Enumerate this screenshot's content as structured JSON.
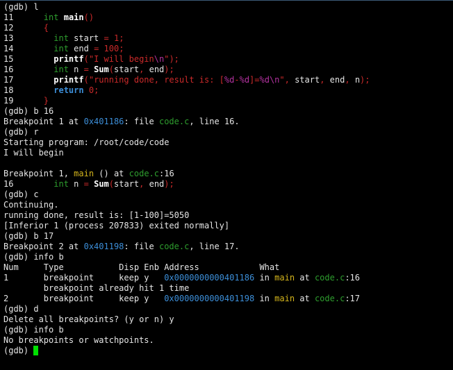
{
  "theme": {
    "background": "#000000",
    "default": "#e6e6e6",
    "cursor": "#00e000",
    "colors": {
      "n": "#e6e6e6",
      "t": "#2e9e2e",
      "k": "#2e9e2e",
      "p": "#cc2a2a",
      "m": "#b2329f",
      "fb": "#ffffff",
      "kb": "#3c8ed8",
      "v": "#cc2a2a",
      "a": "#3c8ed8",
      "f": "#2e9e2e",
      "fn": "#d4b51c"
    }
  },
  "terminal": {
    "lines": [
      [
        [
          "n",
          "(gdb) l"
        ]
      ],
      [
        [
          "n",
          "11      "
        ],
        [
          "t",
          "int"
        ],
        [
          "n",
          " "
        ],
        [
          "fb",
          "main"
        ],
        [
          "p",
          "()"
        ]
      ],
      [
        [
          "n",
          "12      "
        ],
        [
          "p",
          "{"
        ]
      ],
      [
        [
          "n",
          "13        "
        ],
        [
          "t",
          "int"
        ],
        [
          "n",
          " start "
        ],
        [
          "p",
          "="
        ],
        [
          "n",
          " "
        ],
        [
          "v",
          "1"
        ],
        [
          "p",
          ";"
        ]
      ],
      [
        [
          "n",
          "14        "
        ],
        [
          "t",
          "int"
        ],
        [
          "n",
          " end "
        ],
        [
          "p",
          "="
        ],
        [
          "n",
          " "
        ],
        [
          "v",
          "100"
        ],
        [
          "p",
          ";"
        ]
      ],
      [
        [
          "n",
          "15        "
        ],
        [
          "fb",
          "printf"
        ],
        [
          "p",
          "(\""
        ],
        [
          "p",
          "I will begin"
        ],
        [
          "m",
          "\\n"
        ],
        [
          "p",
          "\");"
        ]
      ],
      [
        [
          "n",
          "16        "
        ],
        [
          "t",
          "int"
        ],
        [
          "n",
          " n "
        ],
        [
          "p",
          "="
        ],
        [
          "n",
          " "
        ],
        [
          "fb",
          "Sum"
        ],
        [
          "p",
          "("
        ],
        [
          "n",
          "start"
        ],
        [
          "p",
          ","
        ],
        [
          "n",
          " end"
        ],
        [
          "p",
          ");"
        ]
      ],
      [
        [
          "n",
          "17        "
        ],
        [
          "fb",
          "printf"
        ],
        [
          "p",
          "(\""
        ],
        [
          "p",
          "running done, result is: ["
        ],
        [
          "m",
          "%d"
        ],
        [
          "p",
          "-"
        ],
        [
          "m",
          "%d"
        ],
        [
          "p",
          "]="
        ],
        [
          "m",
          "%d\\n"
        ],
        [
          "p",
          "\","
        ],
        [
          "n",
          " start"
        ],
        [
          "p",
          ","
        ],
        [
          "n",
          " end"
        ],
        [
          "p",
          ","
        ],
        [
          "n",
          " n"
        ],
        [
          "p",
          ");"
        ]
      ],
      [
        [
          "n",
          "18        "
        ],
        [
          "kb",
          "return"
        ],
        [
          "n",
          " "
        ],
        [
          "v",
          "0"
        ],
        [
          "p",
          ";"
        ]
      ],
      [
        [
          "n",
          "19      "
        ],
        [
          "p",
          "}"
        ]
      ],
      [
        [
          "n",
          "(gdb) b 16"
        ]
      ],
      [
        [
          "n",
          "Breakpoint 1 at "
        ],
        [
          "a",
          "0x401186"
        ],
        [
          "n",
          ": file "
        ],
        [
          "f",
          "code.c"
        ],
        [
          "n",
          ", line 16."
        ]
      ],
      [
        [
          "n",
          "(gdb) r"
        ]
      ],
      [
        [
          "n",
          "Starting program: /root/code/code"
        ]
      ],
      [
        [
          "n",
          "I will begin"
        ]
      ],
      [
        [
          "n",
          ""
        ]
      ],
      [
        [
          "n",
          "Breakpoint 1, "
        ],
        [
          "fn",
          "main"
        ],
        [
          "n",
          " () at "
        ],
        [
          "f",
          "code.c"
        ],
        [
          "n",
          ":16"
        ]
      ],
      [
        [
          "n",
          "16        "
        ],
        [
          "t",
          "int"
        ],
        [
          "n",
          " n "
        ],
        [
          "p",
          "="
        ],
        [
          "n",
          " "
        ],
        [
          "fb",
          "Sum"
        ],
        [
          "p",
          "("
        ],
        [
          "n",
          "start"
        ],
        [
          "p",
          ","
        ],
        [
          "n",
          " end"
        ],
        [
          "p",
          ");"
        ]
      ],
      [
        [
          "n",
          "(gdb) c"
        ]
      ],
      [
        [
          "n",
          "Continuing."
        ]
      ],
      [
        [
          "n",
          "running done, result is: [1-100]=5050"
        ]
      ],
      [
        [
          "n",
          "[Inferior 1 (process 207833) exited normally]"
        ]
      ],
      [
        [
          "n",
          "(gdb) b 17"
        ]
      ],
      [
        [
          "n",
          "Breakpoint 2 at "
        ],
        [
          "a",
          "0x401198"
        ],
        [
          "n",
          ": file "
        ],
        [
          "f",
          "code.c"
        ],
        [
          "n",
          ", line 17."
        ]
      ],
      [
        [
          "n",
          "(gdb) info b"
        ]
      ],
      [
        [
          "n",
          "Num     Type           Disp Enb Address            What"
        ]
      ],
      [
        [
          "n",
          "1       breakpoint     keep y   "
        ],
        [
          "a",
          "0x0000000000401186"
        ],
        [
          "n",
          " in "
        ],
        [
          "fn",
          "main"
        ],
        [
          "n",
          " at "
        ],
        [
          "f",
          "code.c"
        ],
        [
          "n",
          ":16"
        ]
      ],
      [
        [
          "n",
          "        breakpoint already hit 1 time"
        ]
      ],
      [
        [
          "n",
          "2       breakpoint     keep y   "
        ],
        [
          "a",
          "0x0000000000401198"
        ],
        [
          "n",
          " in "
        ],
        [
          "fn",
          "main"
        ],
        [
          "n",
          " at "
        ],
        [
          "f",
          "code.c"
        ],
        [
          "n",
          ":17"
        ]
      ],
      [
        [
          "n",
          "(gdb) d"
        ]
      ],
      [
        [
          "n",
          "Delete all breakpoints? (y or n) y"
        ]
      ],
      [
        [
          "n",
          "(gdb) info b"
        ]
      ],
      [
        [
          "n",
          "No breakpoints or watchpoints."
        ]
      ],
      [
        [
          "n",
          "(gdb) "
        ]
      ]
    ]
  }
}
